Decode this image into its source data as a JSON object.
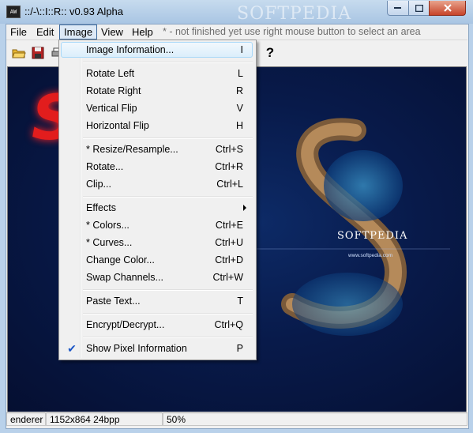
{
  "window": {
    "title": "::/-\\::I::R:: v0.93 Alpha",
    "watermark": "SOFTPEDIA",
    "icon_label": "AW"
  },
  "menubar": {
    "items": [
      "File",
      "Edit",
      "Image",
      "View",
      "Help"
    ],
    "hint": "* - not finished yet    use right mouse button to select an area"
  },
  "toolbar": {
    "icons": [
      "open-folder-icon",
      "save-disk-icon",
      "printer-icon",
      "help-cursor-icon"
    ],
    "help_glyph": "?"
  },
  "canvas": {
    "logo_letter": "S",
    "brand": "SOFTPEDIA",
    "url": "www.softpedia.com"
  },
  "image_menu": {
    "items": [
      {
        "label": "Image Information...",
        "key": "I",
        "highlighted": true
      },
      {
        "label": "Rotate Left",
        "key": "L"
      },
      {
        "label": "Rotate Right",
        "key": "R"
      },
      {
        "label": "Vertical Flip",
        "key": "V"
      },
      {
        "label": "Horizontal Flip",
        "key": "H"
      },
      {
        "label": "* Resize/Resample...",
        "key": "Ctrl+S"
      },
      {
        "label": "Rotate...",
        "key": "Ctrl+R"
      },
      {
        "label": "Clip...",
        "key": "Ctrl+L"
      },
      {
        "label": "Effects",
        "key": "",
        "submenu": true
      },
      {
        "label": "* Colors...",
        "key": "Ctrl+E"
      },
      {
        "label": "* Curves...",
        "key": "Ctrl+U"
      },
      {
        "label": "Change Color...",
        "key": "Ctrl+D"
      },
      {
        "label": "Swap Channels...",
        "key": "Ctrl+W"
      },
      {
        "label": "Paste Text...",
        "key": "T"
      },
      {
        "label": "Encrypt/Decrypt...",
        "key": "Ctrl+Q"
      },
      {
        "label": "Show Pixel Information",
        "key": "P",
        "checked": true
      }
    ]
  },
  "statusbar": {
    "renderer": "enderer",
    "image_info": "1152x864 24bpp",
    "zoom": "50%"
  },
  "colors": {
    "canvas_background": "#081a4a",
    "logo_red": "#e21d1d",
    "check_blue": "#1c57c6",
    "menu_highlight": "#dbeefb"
  }
}
